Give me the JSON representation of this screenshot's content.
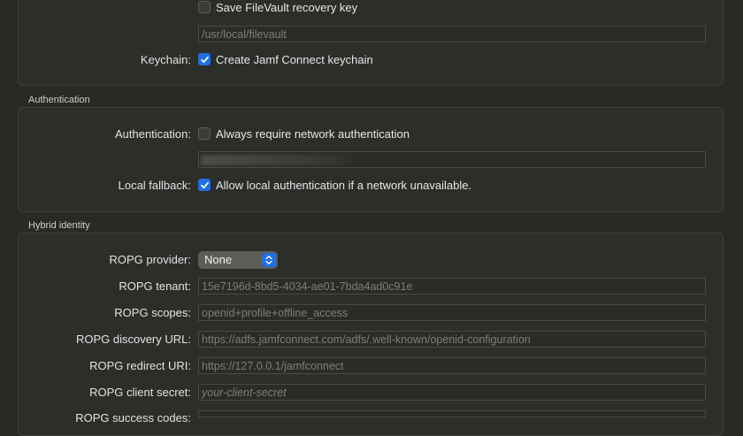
{
  "filevault": {
    "save_key_label": "Save FileVault recovery key",
    "save_key_checked": false,
    "path_value": "/usr/local/filevault",
    "keychain_label": "Keychain:",
    "keychain_option": "Create Jamf Connect keychain",
    "keychain_checked": true
  },
  "authentication": {
    "section_title": "Authentication",
    "auth_label": "Authentication:",
    "auth_option": "Always require network authentication",
    "auth_checked": false,
    "fallback_label": "Local fallback:",
    "fallback_option": "Allow local authentication if a network unavailable.",
    "fallback_checked": true
  },
  "hybrid": {
    "section_title": "Hybrid identity",
    "provider_label": "ROPG provider:",
    "provider_value": "None",
    "tenant_label": "ROPG tenant:",
    "tenant_value": "15e7196d-8bd5-4034-ae01-7bda4ad0c91e",
    "scopes_label": "ROPG scopes:",
    "scopes_value": "openid+profile+offline_access",
    "discovery_label": "ROPG discovery URL:",
    "discovery_value": "https://adfs.jamfconnect.com/adfs/.well-known/openid-configuration",
    "redirect_label": "ROPG redirect URI:",
    "redirect_value": "https://127.0.0.1/jamfconnect",
    "secret_label": "ROPG client secret:",
    "secret_placeholder": "your-client-secret",
    "success_label": "ROPG success codes:"
  },
  "colors": {
    "accent": "#1f6fe5",
    "background": "#272a25",
    "panel": "#2c2e2a"
  }
}
